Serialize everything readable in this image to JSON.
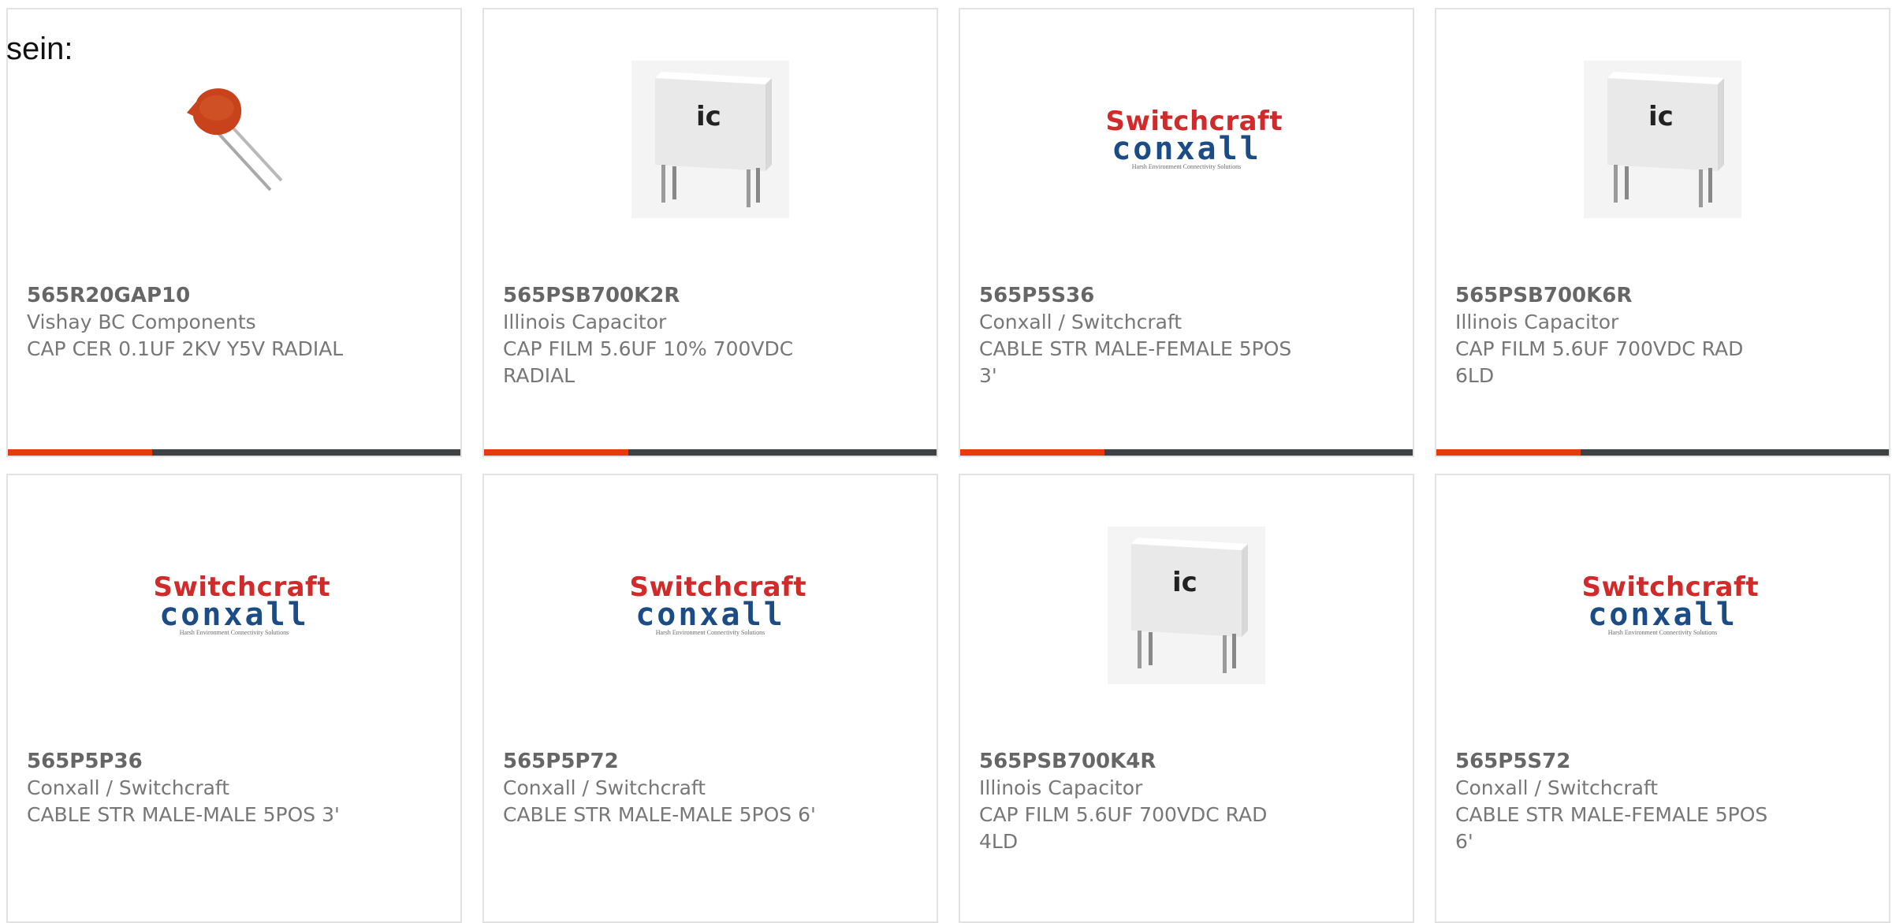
{
  "page": {
    "prefix_text": "sein:"
  },
  "colors": {
    "accent": "#e8380e",
    "bar": "#3f4244",
    "card_border": "#e2e2e2",
    "text": "#777777"
  },
  "logos": {
    "switchcraft": "Switchcraft",
    "conxall": "conxall",
    "tagline": "Harsh Environment Connectivity Solutions",
    "ic": "ic"
  },
  "products": [
    {
      "part_number": "565R20GAP10",
      "manufacturer": "Vishay BC Components",
      "description": "CAP CER 0.1UF 2KV Y5V RADIAL",
      "image": "ceramic-capacitor-image"
    },
    {
      "part_number": "565PSB700K2R",
      "manufacturer": "Illinois Capacitor",
      "description": "CAP FILM 5.6UF 10% 700VDC RADIAL",
      "image": "film-capacitor-image"
    },
    {
      "part_number": "565P5S36",
      "manufacturer": "Conxall / Switchcraft",
      "description": "CABLE STR MALE-FEMALE 5POS 3'",
      "image": "switchcraft-logo"
    },
    {
      "part_number": "565PSB700K6R",
      "manufacturer": "Illinois Capacitor",
      "description": "CAP FILM 5.6UF 700VDC RAD 6LD",
      "image": "film-capacitor-image"
    },
    {
      "part_number": "565P5P36",
      "manufacturer": "Conxall / Switchcraft",
      "description": "CABLE STR MALE-MALE 5POS 3'",
      "image": "switchcraft-logo"
    },
    {
      "part_number": "565P5P72",
      "manufacturer": "Conxall / Switchcraft",
      "description": "CABLE STR MALE-MALE 5POS 6'",
      "image": "switchcraft-logo"
    },
    {
      "part_number": "565PSB700K4R",
      "manufacturer": "Illinois Capacitor",
      "description": "CAP FILM 5.6UF 700VDC RAD 4LD",
      "image": "film-capacitor-image"
    },
    {
      "part_number": "565P5S72",
      "manufacturer": "Conxall / Switchcraft",
      "description": "CABLE STR MALE-FEMALE 5POS 6'",
      "image": "switchcraft-logo"
    }
  ]
}
